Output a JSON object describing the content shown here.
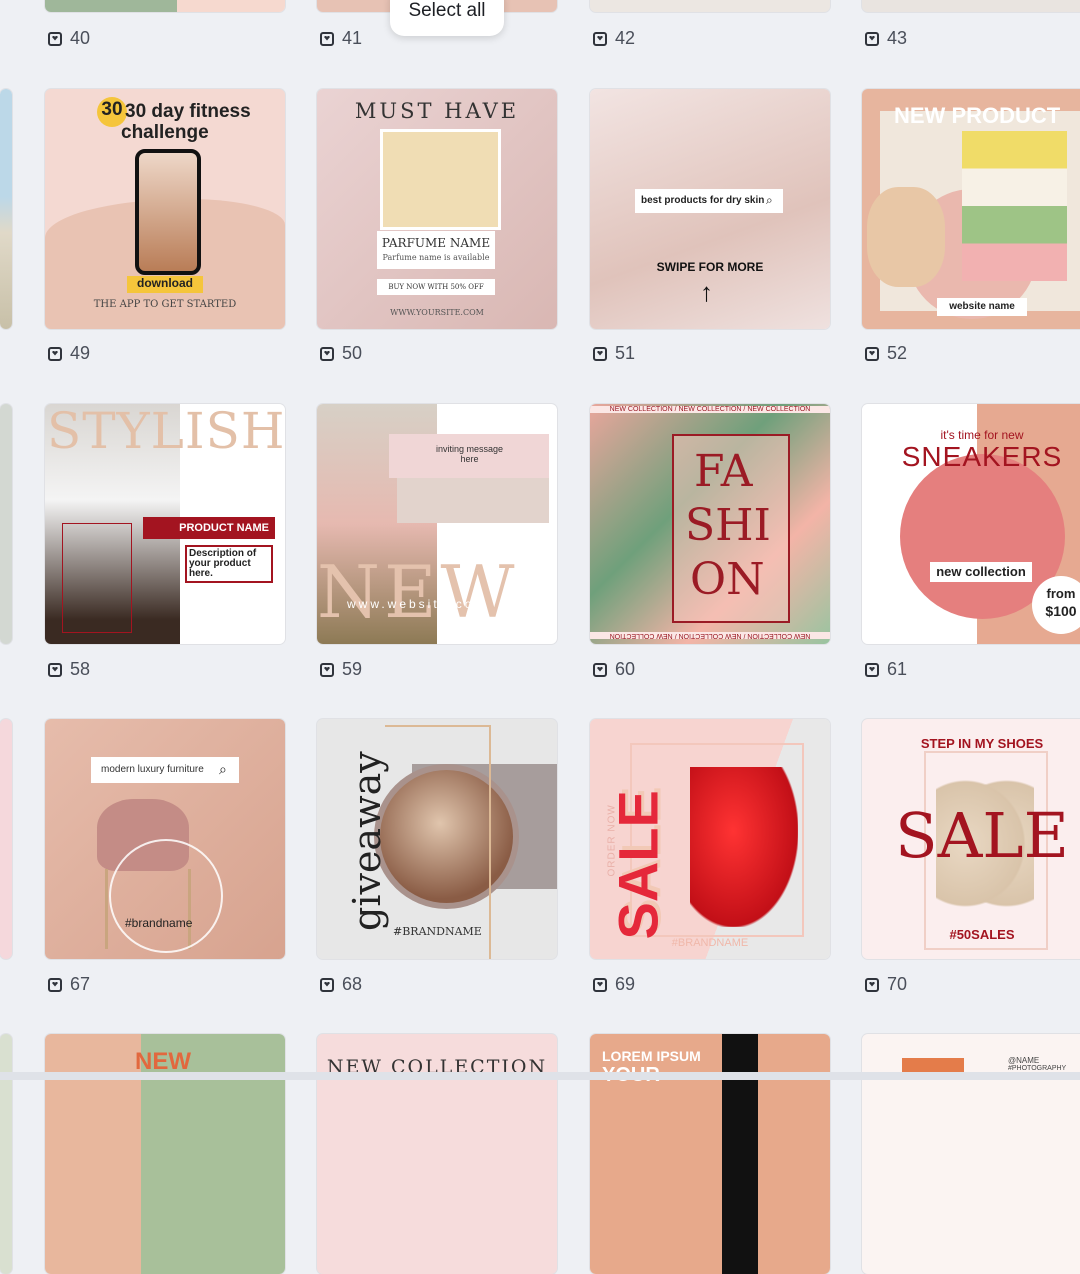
{
  "toolbar": {
    "select_all_label": "Select all"
  },
  "pages": [
    {
      "num": "40"
    },
    {
      "num": "41"
    },
    {
      "num": "42"
    },
    {
      "num": "43"
    },
    {
      "num": "49",
      "texts": {
        "line1": "30 day fitness",
        "line2": "challenge",
        "download": "download",
        "footer": "THE APP TO GET STARTED",
        "thirty": "30"
      }
    },
    {
      "num": "50",
      "texts": {
        "title": "MUST HAVE",
        "name": "PARFUME NAME",
        "sub": "Parfume name is available",
        "buy": "BUY NOW WITH 50% OFF",
        "web": "WWW.YOURSITE.COM"
      }
    },
    {
      "num": "51",
      "texts": {
        "search": "best products for dry skin",
        "swipe": "SWIPE FOR MORE"
      }
    },
    {
      "num": "52",
      "texts": {
        "title": "NEW PRODUCT",
        "site": "website name"
      }
    },
    {
      "num": "58",
      "texts": {
        "title": "STYLISH",
        "product": "PRODUCT NAME",
        "desc": "Description of your product here."
      }
    },
    {
      "num": "59",
      "texts": {
        "msg": "inviting message here",
        "big": "NEW",
        "web": "www.website.com"
      }
    },
    {
      "num": "60",
      "texts": {
        "band": "NEW COLLECTION / NEW COLLECTION / NEW COLLECTION",
        "l1": "FA",
        "l2": "SHI",
        "l3": "ON",
        "band_bottom": "NEW COLLECTION / NEW COLLECTION / NEW COLLECTION"
      }
    },
    {
      "num": "61",
      "texts": {
        "small": "it's time for new",
        "big": "SNEAKERS",
        "tag": "new collection",
        "from": "from",
        "price": "$100"
      }
    },
    {
      "num": "67",
      "texts": {
        "search": "modern luxury furniture",
        "brand": "#brandname"
      }
    },
    {
      "num": "68",
      "texts": {
        "vert": "giveaway",
        "brand": "#BRANDNAME"
      }
    },
    {
      "num": "69",
      "texts": {
        "sale": "SALE",
        "order": "ORDER NOW",
        "brand": "#BRANDNAME"
      }
    },
    {
      "num": "70",
      "texts": {
        "top": "STEP IN MY SHOES",
        "sale": "SALE",
        "tag": "#50SALES"
      }
    },
    {
      "num": "",
      "texts": {
        "big": "NEW"
      }
    },
    {
      "num": "",
      "texts": {
        "big": "NEW COLLECTION"
      }
    },
    {
      "num": "",
      "texts": {
        "l1": "LOREM IPSUM",
        "l2": "YOUR"
      }
    },
    {
      "num": "",
      "texts": {
        "n": "@NAME",
        "p": "#PHOTOGRAPHY"
      }
    }
  ]
}
